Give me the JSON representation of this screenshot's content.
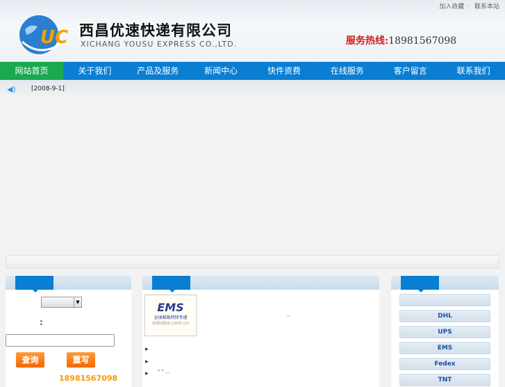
{
  "top_links": [
    "加入收藏",
    "联系本站"
  ],
  "company": {
    "name_cn": "西昌优速快递有限公司",
    "name_en": "XICHANG  YOUSU  EXPRESS  CO.,LTD.",
    "logo_text": "UC"
  },
  "hotline": {
    "label": "服务热线:",
    "number": "18981567098"
  },
  "nav": [
    "网站首页",
    "关于我们",
    "产品及服务",
    "新闻中心",
    "快件资费",
    "在线服务",
    "客户留言",
    "联系我们"
  ],
  "ticker": {
    "date": "[2008-9-1]"
  },
  "left": {
    "colon": ":",
    "buttons": [
      "查询",
      "重写"
    ],
    "phone": "18981567098"
  },
  "middle": {
    "ems": {
      "title": "EMS",
      "sub": "全球邮政特快专递",
      "url": "alibaba.com.cn"
    },
    "ellipsis": "...",
    "items": [
      "",
      "",
      "\"  \" ..."
    ]
  },
  "right": {
    "buttons": [
      "",
      "DHL",
      "UPS",
      "EMS",
      "Fedex",
      "TNT"
    ]
  },
  "colors": {
    "nav": "#0a7ed2",
    "nav_active": "#1aa850",
    "hotline": "#d41a1a",
    "orange": "#f06a00"
  }
}
